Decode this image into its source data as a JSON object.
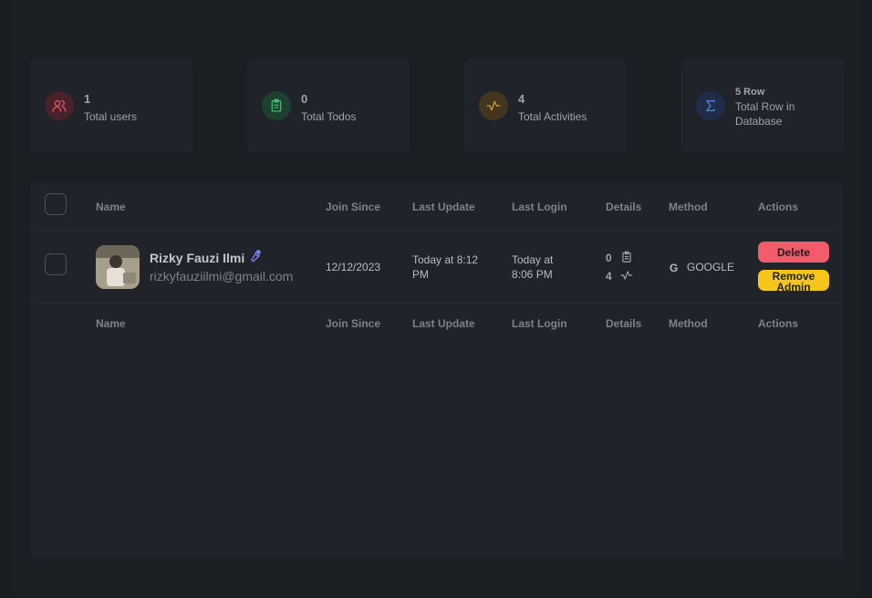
{
  "stats": [
    {
      "value": "1",
      "label": "Total users",
      "icon": "users-icon",
      "color": "#e05569"
    },
    {
      "value": "0",
      "label": "Total Todos",
      "icon": "clipboard-icon",
      "color": "#3dbb75"
    },
    {
      "value": "4",
      "label": "Total Activities",
      "icon": "activity-icon",
      "color": "#d49a34"
    },
    {
      "value": "5 Row",
      "label_line1": "Total Row in",
      "label_line2": "Database",
      "icon": "sigma-icon",
      "color": "#4f7fd6"
    }
  ],
  "table": {
    "headers": {
      "name": "Name",
      "join_since": "Join Since",
      "last_update": "Last Update",
      "last_login": "Last Login",
      "details": "Details",
      "method": "Method",
      "actions": "Actions"
    },
    "rows": [
      {
        "name": "Rizky Fauzi Ilmi",
        "email": "rizkyfauziilmi@gmail.com",
        "join_since": "12/12/2023",
        "last_update_line1": "Today at 8:12",
        "last_update_line2": "PM",
        "last_login_line1": "Today at",
        "last_login_line2": "8:06 PM",
        "todos_count": "0",
        "activities_count": "4",
        "method": "GOOGLE",
        "delete_label": "Delete",
        "remove_admin_line1": "Remove",
        "remove_admin_line2": "Admin",
        "admin_icon": "wrench-icon",
        "colors": {
          "delete": "#f25c6a",
          "remove_admin": "#f5c518",
          "admin_icon": "#7b83f2"
        }
      }
    ]
  }
}
